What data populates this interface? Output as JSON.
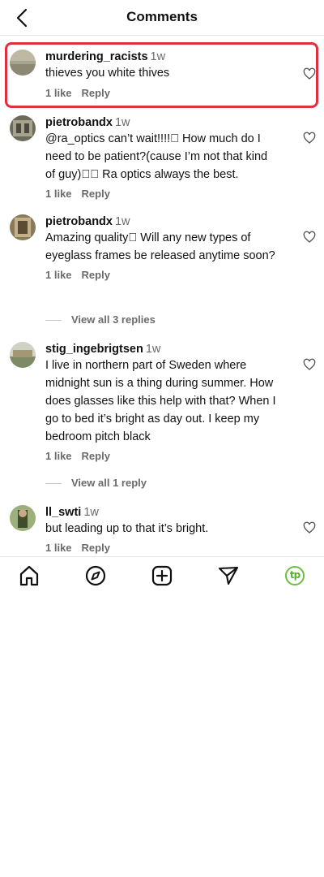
{
  "header": {
    "title": "Comments"
  },
  "comments": [
    {
      "username": "murdering_racists",
      "time": "1w",
      "text": "thieves you white thives",
      "likes": "1 like",
      "reply": "Reply"
    },
    {
      "username": "pietrobandx",
      "time": "1w",
      "text": "@ra_optics can’t wait!!!!\u0000 How much do I need to be patient?(cause I’m not that kind of guy)\u0000\u0000 Ra optics always the best.",
      "likes": "1 like",
      "reply": "Reply"
    },
    {
      "username": "pietrobandx",
      "time": "1w",
      "text": "Amazing quality\u0000 Will any new types of eyeglass frames be released anytime soon?",
      "likes": "1 like",
      "reply": "Reply",
      "view_replies": "View all 3 replies"
    },
    {
      "username": "stig_ingebrigtsen",
      "time": "1w",
      "text": "I live in northern part of Sweden where midnight sun is a thing during summer. How does glasses like this help with that? When I go to bed it’s bright as day out. I keep my bedroom pitch black",
      "likes": "1 like",
      "reply": "Reply",
      "view_replies": "View all 1 reply"
    },
    {
      "username": "ll_swti",
      "time": "1w",
      "text": "but leading up to that it’s bright.",
      "likes": "1 like",
      "reply": "Reply"
    }
  ],
  "tabbar": {
    "icons": [
      "home-icon",
      "explore-icon",
      "create-icon",
      "direct-message-icon",
      "profile-avatar"
    ],
    "profile_initials": "tp"
  },
  "colors": {
    "highlight": "#e0303f",
    "muted": "#6b6b6b",
    "profile_green": "#6abf3f"
  }
}
